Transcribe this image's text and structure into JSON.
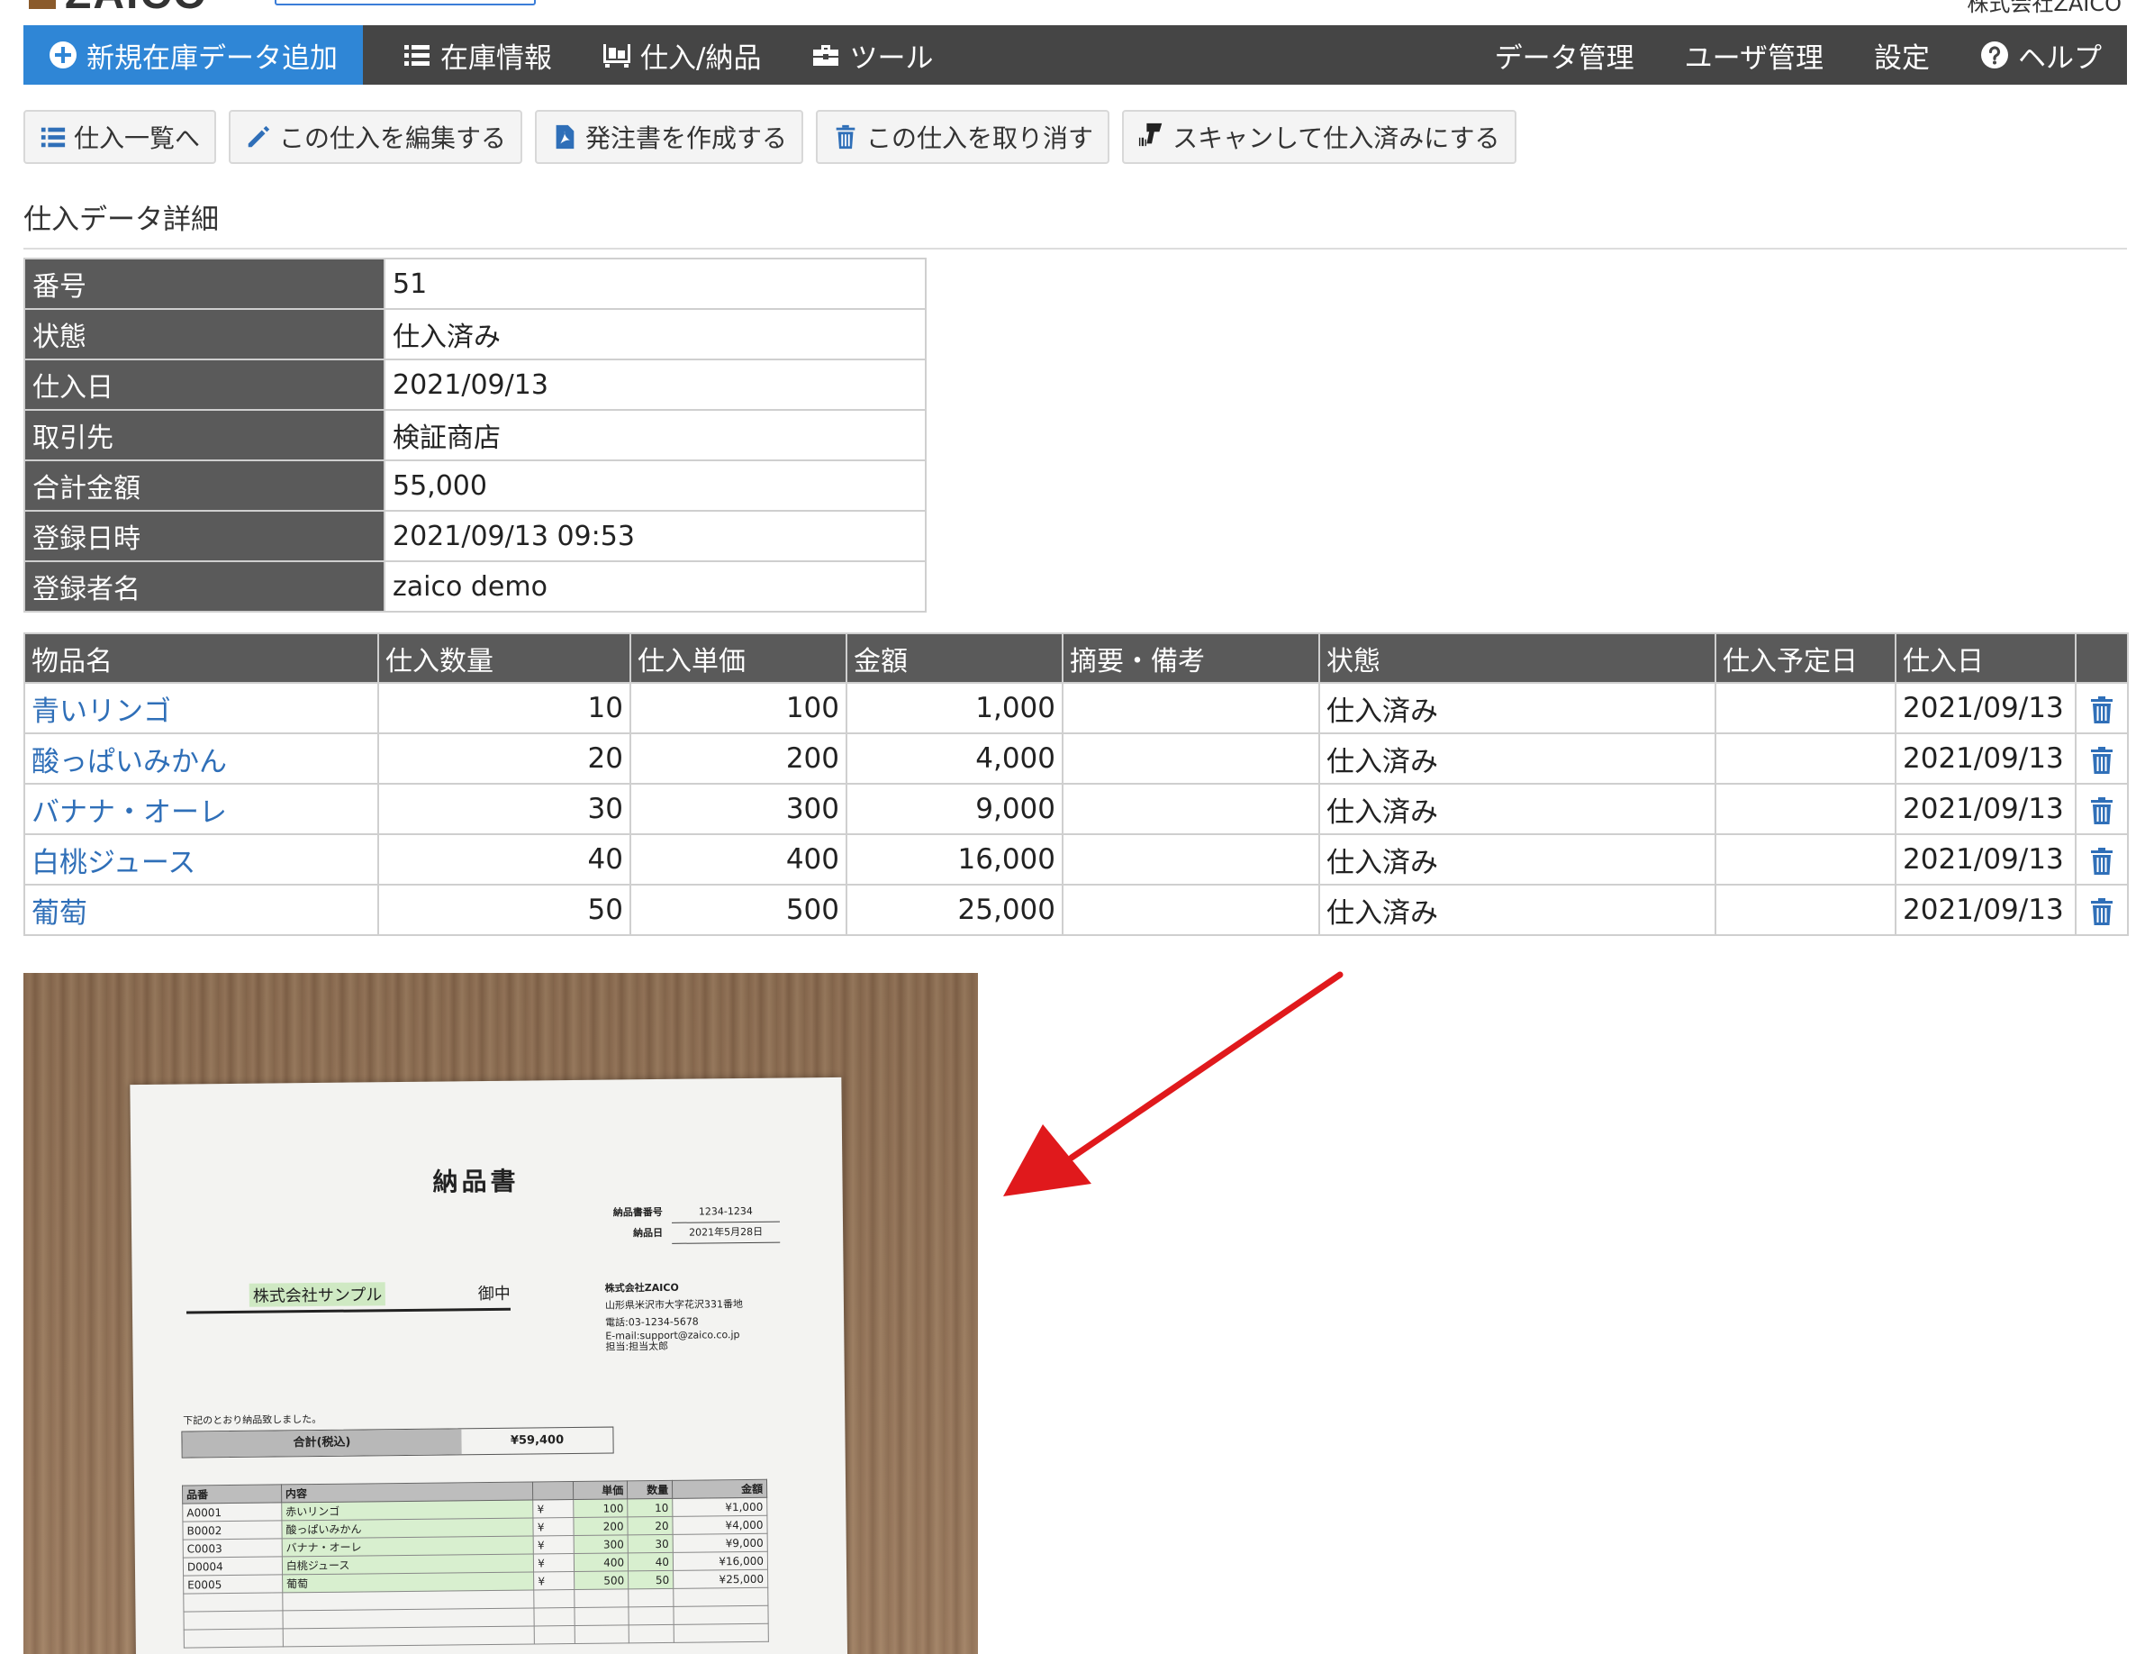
{
  "header": {
    "logo_text": "ZAICO",
    "company": "株式会社ZAICO"
  },
  "nav": {
    "add_label": "新規在庫データ追加",
    "inventory_label": "在庫情報",
    "purchase_label": "仕入/納品",
    "tools_label": "ツール",
    "data_label": "データ管理",
    "users_label": "ユーザ管理",
    "settings_label": "設定",
    "help_label": "ヘルプ"
  },
  "actions": {
    "list": "仕入一覧へ",
    "edit": "この仕入を編集する",
    "order": "発注書を作成する",
    "cancel": "この仕入を取り消す",
    "scan": "スキャンして仕入済みにする"
  },
  "section_title": "仕入データ詳細",
  "detail": [
    {
      "label": "番号",
      "value": "51"
    },
    {
      "label": "状態",
      "value": "仕入済み"
    },
    {
      "label": "仕入日",
      "value": "2021/09/13"
    },
    {
      "label": "取引先",
      "value": "検証商店"
    },
    {
      "label": "合計金額",
      "value": "55,000"
    },
    {
      "label": "登録日時",
      "value": "2021/09/13 09:53"
    },
    {
      "label": "登録者名",
      "value": "zaico demo"
    }
  ],
  "items_table": {
    "headers": [
      "物品名",
      "仕入数量",
      "仕入単価",
      "金額",
      "摘要・備考",
      "状態",
      "仕入予定日",
      "仕入日",
      ""
    ],
    "rows": [
      {
        "name": "青いリンゴ",
        "qty": "10",
        "unit_price": "100",
        "amount": "1,000",
        "note": "",
        "status": "仕入済み",
        "planned": "",
        "date": "2021/09/13"
      },
      {
        "name": "酸っぱいみかん",
        "qty": "20",
        "unit_price": "200",
        "amount": "4,000",
        "note": "",
        "status": "仕入済み",
        "planned": "",
        "date": "2021/09/13"
      },
      {
        "name": "バナナ・オーレ",
        "qty": "30",
        "unit_price": "300",
        "amount": "9,000",
        "note": "",
        "status": "仕入済み",
        "planned": "",
        "date": "2021/09/13"
      },
      {
        "name": "白桃ジュース",
        "qty": "40",
        "unit_price": "400",
        "amount": "16,000",
        "note": "",
        "status": "仕入済み",
        "planned": "",
        "date": "2021/09/13"
      },
      {
        "name": "葡萄",
        "qty": "50",
        "unit_price": "500",
        "amount": "25,000",
        "note": "",
        "status": "仕入済み",
        "planned": "",
        "date": "2021/09/13"
      }
    ]
  },
  "photo": {
    "title": "納品書",
    "meta": [
      {
        "label": "納品書番号",
        "value": "1234-1234"
      },
      {
        "label": "納品日",
        "value": "2021年5月28日"
      }
    ],
    "to_name": "株式会社サンプル",
    "to_suffix": "御中",
    "from": [
      "株式会社ZAICO",
      "山形県米沢市大字花沢331番地",
      "電話:03-1234-5678",
      "E-mail:support@zaico.co.jp",
      "担当:担当太郎"
    ],
    "note": "下記のとおり納品致しました。",
    "total_label": "合計(税込)",
    "total_value": "¥59,400",
    "item_headers": [
      "品番",
      "内容",
      "",
      "単価",
      "数量",
      "金額"
    ],
    "items": [
      {
        "code": "A0001",
        "name": "赤いリンゴ",
        "yen": "¥",
        "price": "100",
        "qty": "10",
        "amount": "¥1,000"
      },
      {
        "code": "B0002",
        "name": "酸っぱいみかん",
        "yen": "¥",
        "price": "200",
        "qty": "20",
        "amount": "¥4,000"
      },
      {
        "code": "C0003",
        "name": "バナナ・オーレ",
        "yen": "¥",
        "price": "300",
        "qty": "30",
        "amount": "¥9,000"
      },
      {
        "code": "D0004",
        "name": "白桃ジュース",
        "yen": "¥",
        "price": "400",
        "qty": "40",
        "amount": "¥16,000"
      },
      {
        "code": "E0005",
        "name": "葡萄",
        "yen": "¥",
        "price": "500",
        "qty": "50",
        "amount": "¥25,000"
      }
    ]
  },
  "colors": {
    "nav_bg": "#454545",
    "nav_active": "#2f86d6",
    "link": "#2f6fb8",
    "table_head": "#5a5a5a",
    "arrow": "#e0191c"
  }
}
